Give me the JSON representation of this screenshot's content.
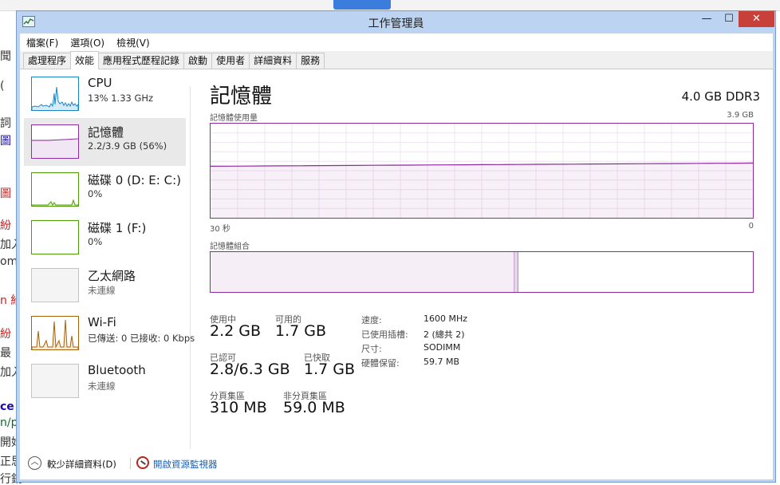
{
  "background": {
    "fragments": [
      "聞",
      "(",
      "詞",
      "圖",
      "圖",
      "紛",
      "加入",
      "om",
      "n 紛",
      "紛",
      "最",
      "加入",
      "ce",
      "n/p",
      "開始",
      "正思",
      "行銷"
    ]
  },
  "window": {
    "title": "工作管理員",
    "controls": {
      "minimize": "—",
      "maximize": "☐",
      "close": "✕"
    }
  },
  "menu": [
    "檔案(F)",
    "選項(O)",
    "檢視(V)"
  ],
  "tabs": [
    "處理程序",
    "效能",
    "應用程式歷程記錄",
    "啟動",
    "使用者",
    "詳細資料",
    "服務"
  ],
  "active_tab": "效能",
  "sidebar": [
    {
      "name": "CPU",
      "sub": "13%  1.33 GHz"
    },
    {
      "name": "記憶體",
      "sub": "2.2/3.9 GB (56%)"
    },
    {
      "name": "磁碟 0 (D: E: C:)",
      "sub": "0%"
    },
    {
      "name": "磁碟 1 (F:)",
      "sub": "0%"
    },
    {
      "name": "乙太網路",
      "sub": "未連線"
    },
    {
      "name": "Wi-Fi",
      "sub": "已傳送: 0 已接收: 0 Kbps"
    },
    {
      "name": "Bluetooth",
      "sub": "未連線"
    }
  ],
  "main": {
    "title": "記憶體",
    "spec": "4.0 GB DDR3",
    "usage_label": "記憶體使用量",
    "usage_max": "3.9 GB",
    "time_label": "30 秒",
    "time_end": "0",
    "composition_label": "記憶體組合",
    "usage_fraction": 0.56,
    "stats": {
      "in_use_label": "使用中",
      "in_use": "2.2 GB",
      "available_label": "可用的",
      "available": "1.7 GB",
      "committed_label": "已認可",
      "committed": "2.8/6.3 GB",
      "cached_label": "已快取",
      "cached": "1.7 GB",
      "paged_label": "分頁集區",
      "paged": "310 MB",
      "nonpaged_label": "非分頁集區",
      "nonpaged": "59.0 MB"
    },
    "specs": [
      {
        "key": "速度:",
        "value": "1600 MHz"
      },
      {
        "key": "已使用插槽:",
        "value": "2 (總共 2)"
      },
      {
        "key": "尺寸:",
        "value": "SODIMM"
      },
      {
        "key": "硬體保留:",
        "value": "59.7 MB"
      }
    ]
  },
  "footer": {
    "fewer_details": "較少詳細資料(D)",
    "open_monitor": "開啟資源監視器"
  },
  "colors": {
    "memory_accent": "#8b2a9d",
    "cpu_accent": "#1a86c7",
    "disk_accent": "#4d9a0b",
    "wifi_accent": "#a6620a",
    "close_button": "#c7403a",
    "frame": "#bcd3f1"
  }
}
